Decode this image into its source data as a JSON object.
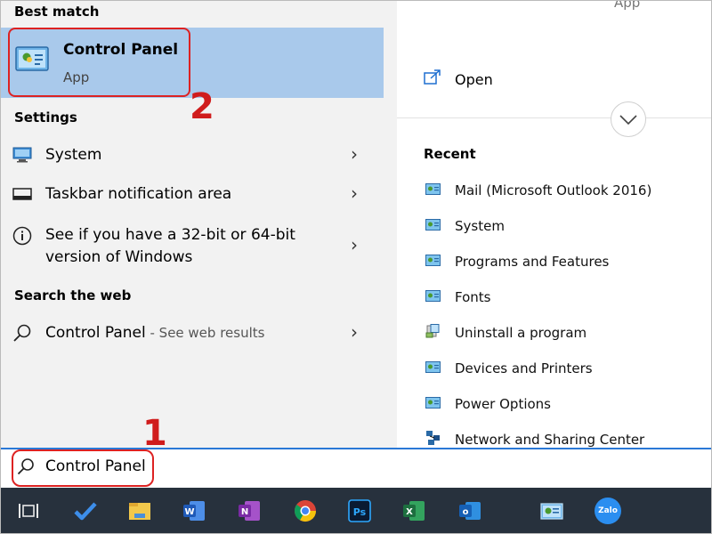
{
  "best_match": {
    "section_title": "Best match",
    "title": "Control Panel",
    "subtitle": "App"
  },
  "settings": {
    "section_title": "Settings",
    "items": [
      {
        "label": "System",
        "icon": "monitor-icon"
      },
      {
        "label": "Taskbar notification area",
        "icon": "taskbar-icon"
      },
      {
        "label_line1": "See if you have a 32-bit or 64-bit",
        "label_line2": "version of Windows",
        "icon": "info-icon"
      }
    ]
  },
  "web": {
    "section_title": "Search the web",
    "item_label": "Control Panel",
    "item_sub": " - See web results"
  },
  "preview": {
    "top_app_label": "App",
    "open_label": "Open",
    "recent_title": "Recent",
    "recent_items": [
      "Mail (Microsoft Outlook 2016)",
      "System",
      "Programs and Features",
      "Fonts",
      "Uninstall a program",
      "Devices and Printers",
      "Power Options",
      "Network and Sharing Center"
    ]
  },
  "search": {
    "value": "Control Panel"
  },
  "taskbar": {
    "icons": [
      "task-view-icon",
      "todo-icon",
      "file-explorer-icon",
      "word-icon",
      "onenote-icon",
      "chrome-icon",
      "photoshop-icon",
      "excel-icon",
      "outlook-icon",
      "control-panel-icon",
      "zalo-icon"
    ],
    "zalo_label": "Zalo"
  },
  "annotations": {
    "step1": "1",
    "step2": "2"
  },
  "colors": {
    "highlight": "#a9c9eb",
    "annotation": "#d01c1c",
    "taskbar": "#27313d",
    "search_border": "#2a78d6"
  }
}
